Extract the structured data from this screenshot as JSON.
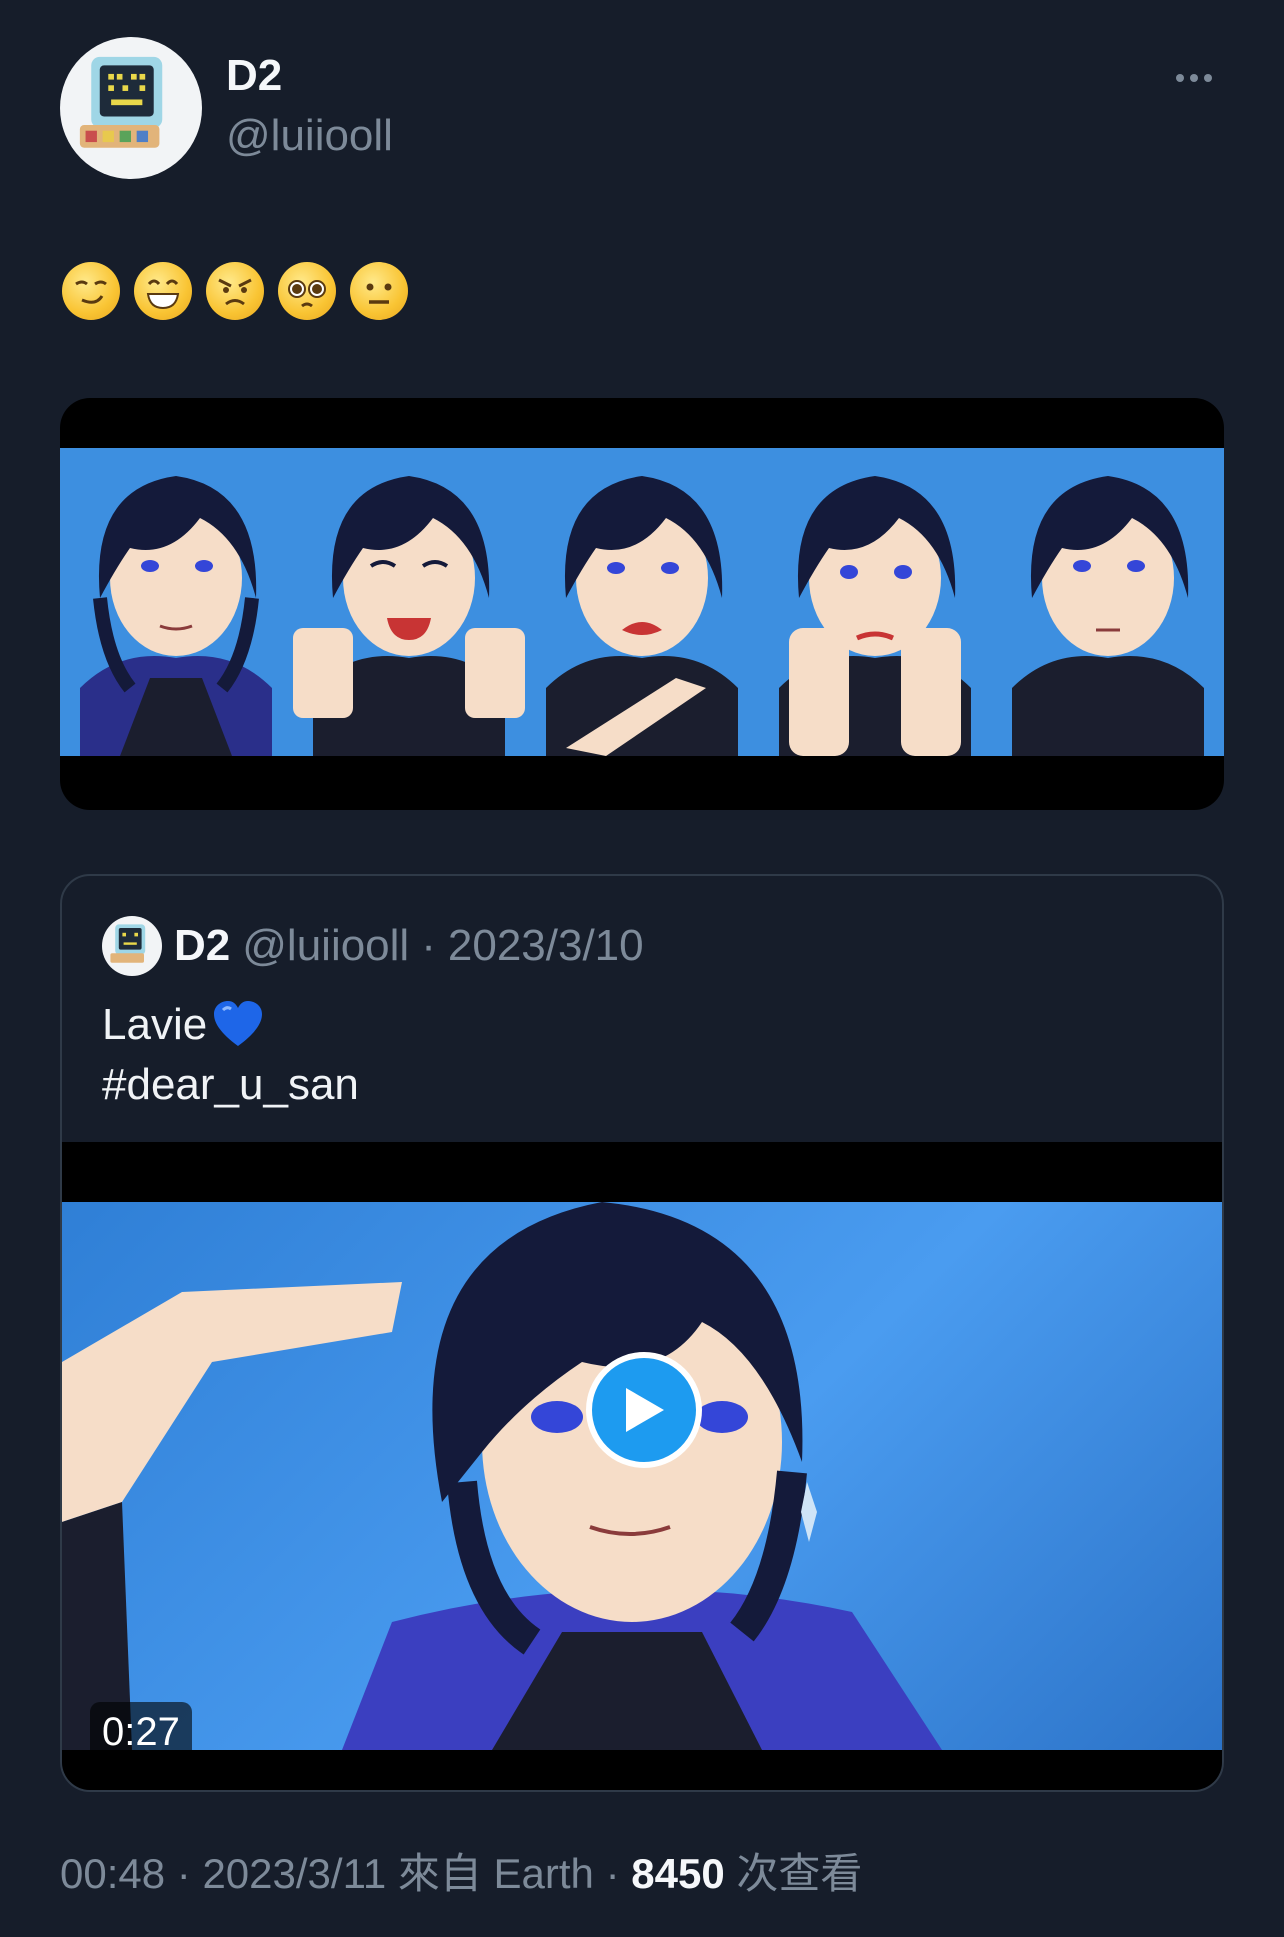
{
  "author": {
    "display_name": "D2",
    "handle": "@luiiooll"
  },
  "tweet": {
    "emoji_icons": [
      "smirking-face-icon",
      "grinning-face-icon",
      "angry-face-icon",
      "pleading-face-icon",
      "neutral-face-icon"
    ]
  },
  "quoted_tweet": {
    "display_name": "D2",
    "handle": "@luiiooll",
    "separator": "·",
    "date": "2023/3/10",
    "text_line1": "Lavie",
    "text_line2": "#dear_u_san",
    "video_duration": "0:27"
  },
  "footer": {
    "time": "00:48",
    "sep1": "·",
    "date": "2023/3/11",
    "source": "來自 Earth",
    "sep2": "·",
    "views": "8450",
    "views_suffix": "次查看"
  },
  "colors": {
    "background": "#161d2a",
    "secondary_text": "#7d8a99",
    "accent": "#1d9bf0"
  }
}
